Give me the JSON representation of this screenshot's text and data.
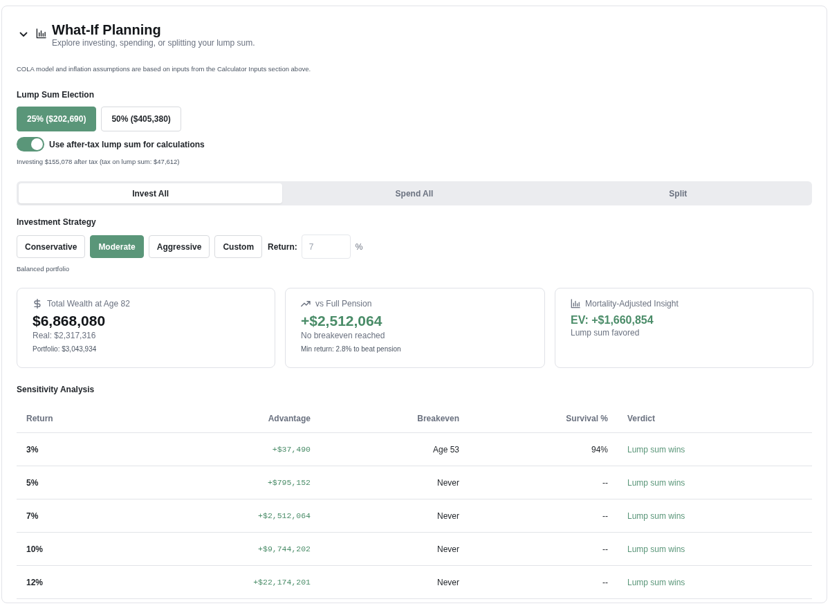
{
  "section": {
    "title": "What-If Planning",
    "subtitle": "Explore investing, spending, or splitting your lump sum.",
    "expanded": true
  },
  "note": "COLA model and inflation assumptions are based on inputs from the Calculator Inputs section above.",
  "lump_sum_election": {
    "label": "Lump Sum Election",
    "options": [
      {
        "label": "25% ($202,690)",
        "selected": true
      },
      {
        "label": "50% ($405,380)",
        "selected": false
      }
    ],
    "after_tax_toggle": {
      "label": "Use after-tax lump sum for calculations",
      "on": true
    },
    "detail": "Investing $155,078 after tax (tax on lump sum: $47,612)"
  },
  "tabs": [
    {
      "label": "Invest All",
      "selected": true
    },
    {
      "label": "Spend All",
      "selected": false
    },
    {
      "label": "Split",
      "selected": false
    }
  ],
  "investment_strategy": {
    "label": "Investment Strategy",
    "options": [
      {
        "label": "Conservative",
        "selected": false
      },
      {
        "label": "Moderate",
        "selected": true
      },
      {
        "label": "Aggressive",
        "selected": false
      },
      {
        "label": "Custom",
        "selected": false
      }
    ],
    "return_field": {
      "label": "Return:",
      "placeholder": "7",
      "unit": "%"
    },
    "description": "Balanced portfolio"
  },
  "cards": [
    {
      "kind": "wealth",
      "title": "Total Wealth at Age 82",
      "value": "$6,868,080",
      "detail": "Real: $2,317,316",
      "footnote": "Portfolio: $3,043,934"
    },
    {
      "kind": "versus",
      "title": "vs Full Pension",
      "value": "+$2,512,064",
      "detail": "No breakeven reached",
      "footnote": "Min return: 2.8% to beat pension"
    },
    {
      "kind": "insight",
      "title": "Mortality-Adjusted Insight",
      "value": "EV: +$1,660,854",
      "detail": "Lump sum favored"
    }
  ],
  "sensitivity": {
    "title": "Sensitivity Analysis",
    "columns": [
      "Return",
      "Advantage",
      "Breakeven",
      "Survival %",
      "Verdict"
    ],
    "rows": [
      [
        "3%",
        "+$37,490",
        "Age 53",
        "94%",
        "Lump sum wins"
      ],
      [
        "5%",
        "+$795,152",
        "Never",
        "--",
        "Lump sum wins"
      ],
      [
        "7%",
        "+$2,512,064",
        "Never",
        "--",
        "Lump sum wins"
      ],
      [
        "10%",
        "+$9,744,202",
        "Never",
        "--",
        "Lump sum wins"
      ],
      [
        "12%",
        "+$22,174,201",
        "Never",
        "--",
        "Lump sum wins"
      ]
    ]
  }
}
